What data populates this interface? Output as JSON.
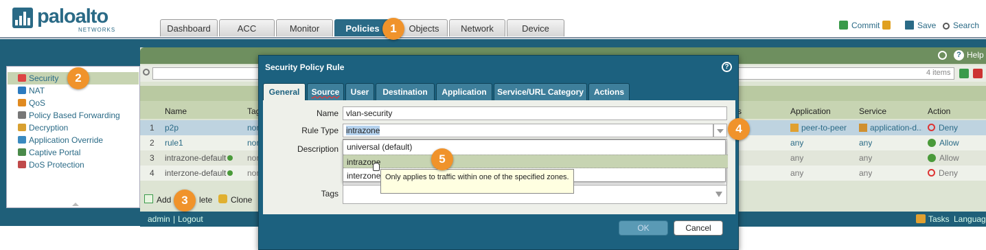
{
  "brand": {
    "name": "paloalto",
    "sub": "NETWORKS"
  },
  "tabs": [
    "Dashboard",
    "ACC",
    "Monitor",
    "Policies",
    "Objects",
    "Network",
    "Device"
  ],
  "top_links": {
    "commit": "Commit",
    "save": "Save",
    "search": "Search"
  },
  "callouts": [
    "1",
    "2",
    "3",
    "4",
    "5"
  ],
  "sidebar": [
    "Security",
    "NAT",
    "QoS",
    "Policy Based Forwarding",
    "Decryption",
    "Application Override",
    "Captive Portal",
    "DoS Protection"
  ],
  "header_right": {
    "help": "Help"
  },
  "filter": {
    "count": "4 items"
  },
  "columns": {
    "name": "Name",
    "tags": "Tag",
    "zone": "s",
    "application": "Application",
    "service": "Service",
    "action": "Action"
  },
  "rules": [
    {
      "num": "1",
      "name": "p2p",
      "tag": "non",
      "application": "peer-to-peer",
      "service": "application-d...",
      "action": "Deny"
    },
    {
      "num": "2",
      "name": "rule1",
      "tag": "non",
      "application": "any",
      "service": "any",
      "action": "Allow"
    },
    {
      "num": "3",
      "name": "intrazone-default",
      "tag": "non",
      "application": "any",
      "service": "any",
      "action": "Allow"
    },
    {
      "num": "4",
      "name": "interzone-default",
      "tag": "non",
      "application": "any",
      "service": "any",
      "action": "Deny"
    }
  ],
  "bottom_actions": {
    "add": "Add",
    "delete": "lete",
    "clone": "Clone"
  },
  "status": {
    "user": "admin",
    "logout": "Logout",
    "tasks": "Tasks",
    "language": "Language"
  },
  "dialog": {
    "title": "Security Policy Rule",
    "tabs": [
      "General",
      "Source",
      "User",
      "Destination",
      "Application",
      "Service/URL Category",
      "Actions"
    ],
    "fields": {
      "name_label": "Name",
      "name_value": "vlan-security",
      "ruletype_label": "Rule Type",
      "ruletype_value": "intrazone",
      "description_label": "Description",
      "tags_label": "Tags"
    },
    "options": [
      "universal (default)",
      "intrazone",
      "interzone"
    ],
    "tooltip": "Only applies to traffic within one of the specified zones.",
    "ok": "OK",
    "cancel": "Cancel"
  },
  "colors": {
    "brand": "#2a6a86",
    "callout": "#f0932b",
    "band": "#1f5f79",
    "deny": "#d33",
    "allow": "#4a9a3a"
  }
}
